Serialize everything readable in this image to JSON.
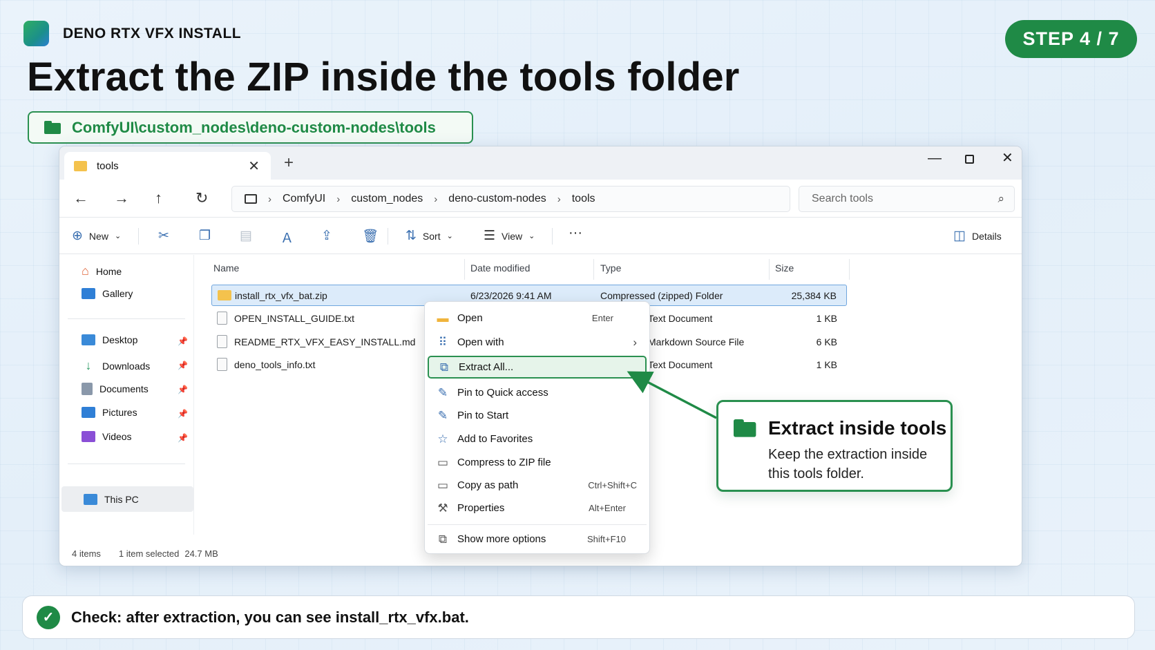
{
  "brand": {
    "name": "DENO RTX VFX INSTALL"
  },
  "step": {
    "label": "STEP 4 / 7"
  },
  "title": "Extract the ZIP inside the tools folder",
  "path_pill": {
    "text": "ComfyUI\\custom_nodes\\deno-custom-nodes\\tools",
    "icon": "folder-icon"
  },
  "window": {
    "tab": {
      "label": "tools"
    },
    "breadcrumbs": [
      "ComfyUI",
      "custom_nodes",
      "deno-custom-nodes",
      "tools"
    ],
    "search": {
      "placeholder": "Search tools"
    },
    "toolbar": {
      "new_label": "New",
      "sort_label": "Sort",
      "view_label": "View",
      "details_label": "Details"
    },
    "sidebar": {
      "top": [
        {
          "label": "Home"
        },
        {
          "label": "Gallery"
        }
      ],
      "quick": [
        {
          "label": "Desktop"
        },
        {
          "label": "Downloads"
        },
        {
          "label": "Documents"
        },
        {
          "label": "Pictures"
        },
        {
          "label": "Videos"
        }
      ],
      "this_pc": "This PC"
    },
    "columns": [
      "Name",
      "Date modified",
      "Type",
      "Size"
    ],
    "files": [
      {
        "name": "install_rtx_vfx_bat.zip",
        "date": "6/23/2026 9:41 AM",
        "type": "Compressed (zipped) Folder",
        "size": "25,384 KB",
        "selected": true
      },
      {
        "name": "OPEN_INSTALL_GUIDE.txt",
        "date": "",
        "type": "Text Document",
        "size": "1 KB"
      },
      {
        "name": "README_RTX_VFX_EASY_INSTALL.md",
        "date": "",
        "type": "Markdown Source File",
        "size": "6 KB"
      },
      {
        "name": "deno_tools_info.txt",
        "date": "",
        "type": "Text Document",
        "size": "1 KB"
      }
    ],
    "status": {
      "items": "4 items",
      "selected": "1 item selected",
      "size": "24.7 MB"
    }
  },
  "context_menu": {
    "items": [
      {
        "label": "Open",
        "shortcut": "Enter"
      },
      {
        "label": "Open with",
        "shortcut": "›"
      },
      {
        "label": "Extract All...",
        "shortcut": "",
        "highlighted": true
      },
      {
        "label": "Pin to Quick access",
        "shortcut": ""
      },
      {
        "label": "Pin to Start",
        "shortcut": ""
      },
      {
        "label": "Add to Favorites",
        "shortcut": ""
      },
      {
        "label": "Compress to ZIP file",
        "shortcut": ""
      },
      {
        "label": "Copy as path",
        "shortcut": "Ctrl+Shift+C"
      },
      {
        "label": "Properties",
        "shortcut": "Alt+Enter"
      },
      {
        "label": "Show more options",
        "shortcut": "Shift+F10"
      }
    ]
  },
  "callout": {
    "title": "Extract inside tools",
    "body": "Keep the extraction inside this tools folder."
  },
  "check": {
    "text": "Check: after extraction, you can see install_rtx_vfx.bat."
  },
  "colors": {
    "accent_green": "#1f8a46",
    "selection_blue": "#dcebfa"
  }
}
